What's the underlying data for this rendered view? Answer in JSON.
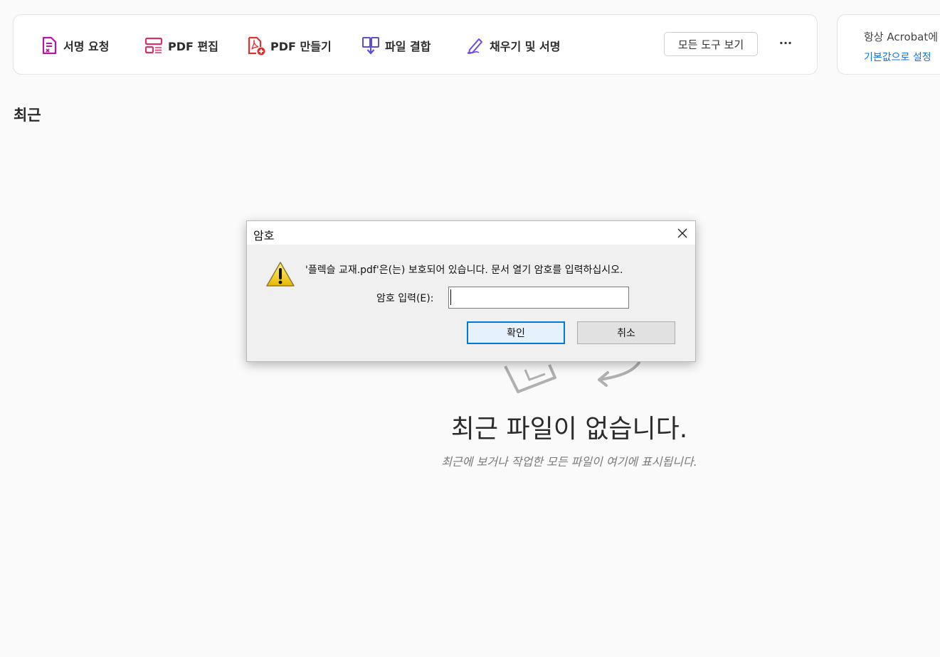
{
  "toolbar": {
    "tools": [
      {
        "label": "서명 요청",
        "icon": "request-signature-icon",
        "color": "#b5179e"
      },
      {
        "label": "PDF 편집",
        "icon": "edit-pdf-icon",
        "color": "#d6336c"
      },
      {
        "label": "PDF 만들기",
        "icon": "create-pdf-icon",
        "color": "#e03131"
      },
      {
        "label": "파일 결합",
        "icon": "combine-files-icon",
        "color": "#5b4fd6"
      },
      {
        "label": "채우기 및 서명",
        "icon": "fill-sign-icon",
        "color": "#7048e8"
      }
    ],
    "all_tools_label": "모든 도구 보기",
    "more_label": "···"
  },
  "side_card": {
    "line1": "항상 Acrobat에",
    "line2": "기본값으로 설정"
  },
  "recent": {
    "title": "최근",
    "empty_title": "최근 파일이 없습니다.",
    "empty_subtitle": "최근에 보거나 작업한 모든 파일이 여기에 표시됩니다."
  },
  "dialog": {
    "title": "암호",
    "message": "'플렉슬 교재.pdf'은(는) 보호되어 있습니다. 문서 열기 암호를 입력하십시오.",
    "password_label": "암호 입력(E):",
    "password_value": "",
    "ok_label": "확인",
    "cancel_label": "취소"
  },
  "colors": {
    "accent": "#0078d7",
    "link": "#1473e6"
  }
}
